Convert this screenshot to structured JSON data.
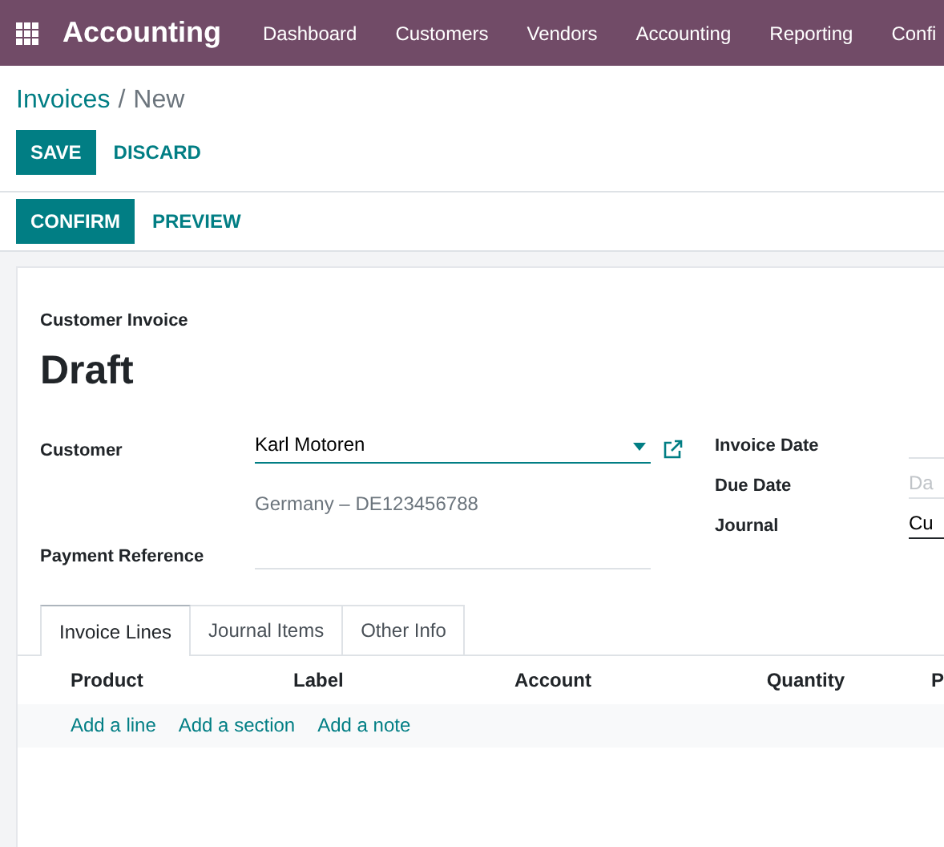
{
  "navbar": {
    "app_title": "Accounting",
    "menu": [
      "Dashboard",
      "Customers",
      "Vendors",
      "Accounting",
      "Reporting",
      "Confi"
    ]
  },
  "breadcrumb": {
    "parent": "Invoices",
    "separator": "/",
    "current": "New"
  },
  "actions": [
    {
      "label": "SAVE",
      "kind": "primary"
    },
    {
      "label": "DISCARD",
      "kind": "link"
    }
  ],
  "status_actions": [
    {
      "label": "CONFIRM",
      "kind": "primary"
    },
    {
      "label": "PREVIEW",
      "kind": "link"
    }
  ],
  "form": {
    "type": "Customer Invoice",
    "state": "Draft",
    "left_fields": [
      {
        "label": "Customer",
        "value": "Karl Motoren",
        "kind": "many2one",
        "focused": true,
        "address": "Germany – DE123456788"
      },
      {
        "label": "Payment Reference",
        "kind": "text",
        "focused": false
      }
    ],
    "right_fields": [
      {
        "label": "Invoice Date"
      },
      {
        "label": "Due Date",
        "placeholder": "Da"
      },
      {
        "label": "Journal",
        "value": "Cu"
      }
    ]
  },
  "tabs": [
    {
      "label": "Invoice Lines",
      "selected": true
    },
    {
      "label": "Journal Items",
      "selected": false
    },
    {
      "label": "Other Info",
      "selected": false
    }
  ],
  "table": {
    "columns": [
      "Product",
      "Label",
      "Account",
      "Quantity",
      "P"
    ],
    "add_links": [
      "Add a line",
      "Add a section",
      "Add a note"
    ]
  }
}
